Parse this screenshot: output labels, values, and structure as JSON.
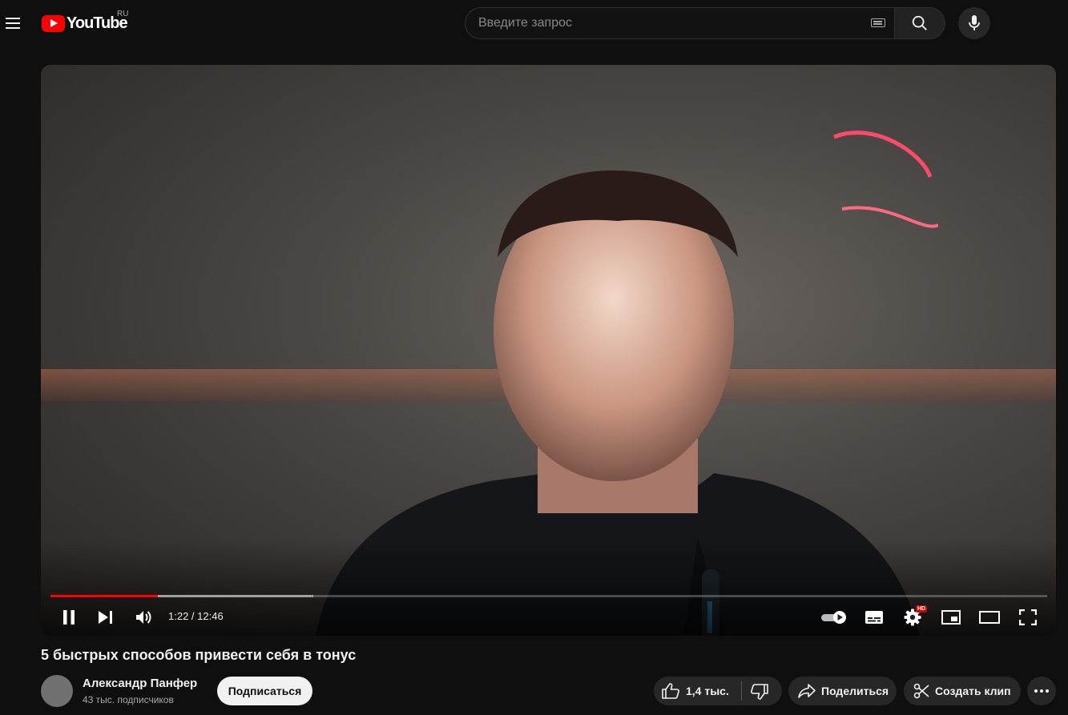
{
  "header": {
    "logo_text": "YouTube",
    "region": "RU",
    "search_placeholder": "Введите запрос"
  },
  "player": {
    "current_time": "1:22",
    "duration": "12:46",
    "time_display": "1:22 / 12:46",
    "progress_played": 0.108,
    "progress_loaded": 0.264,
    "quality_badge": "HD",
    "state": "playing"
  },
  "video": {
    "title": "5 быстрых способов привести себя в тонус"
  },
  "channel": {
    "name": "Александр Панфер",
    "subscribers": "43 тыс. подписчиков",
    "subscribe_label": "Подписаться"
  },
  "actions": {
    "like_count": "1,4 тыс.",
    "share_label": "Поделиться",
    "clip_label": "Создать клип"
  },
  "colors": {
    "accent": "#ff0000",
    "background": "#0f0f0f",
    "pill": "#272727"
  }
}
